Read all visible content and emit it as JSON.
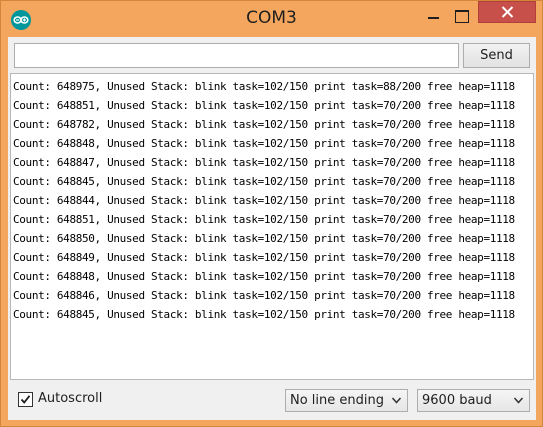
{
  "window": {
    "title": "COM3",
    "app_icon": "arduino-logo-icon",
    "controls": [
      "minimize-icon",
      "maximize-icon",
      "close-icon"
    ]
  },
  "send_bar": {
    "input_value": "",
    "send_label": "Send"
  },
  "output": {
    "lines": [
      "Count: 648975, Unused Stack: blink task=102/150 print task=88/200 free heap=1118",
      "Count: 648851, Unused Stack: blink task=102/150 print task=70/200 free heap=1118",
      "Count: 648782, Unused Stack: blink task=102/150 print task=70/200 free heap=1118",
      "Count: 648848, Unused Stack: blink task=102/150 print task=70/200 free heap=1118",
      "Count: 648847, Unused Stack: blink task=102/150 print task=70/200 free heap=1118",
      "Count: 648845, Unused Stack: blink task=102/150 print task=70/200 free heap=1118",
      "Count: 648844, Unused Stack: blink task=102/150 print task=70/200 free heap=1118",
      "Count: 648851, Unused Stack: blink task=102/150 print task=70/200 free heap=1118",
      "Count: 648850, Unused Stack: blink task=102/150 print task=70/200 free heap=1118",
      "Count: 648849, Unused Stack: blink task=102/150 print task=70/200 free heap=1118",
      "Count: 648848, Unused Stack: blink task=102/150 print task=70/200 free heap=1118",
      "Count: 648846, Unused Stack: blink task=102/150 print task=70/200 free heap=1118",
      "Count: 648845, Unused Stack: blink task=102/150 print task=70/200 free heap=1118"
    ]
  },
  "footer": {
    "autoscroll_label": "Autoscroll",
    "autoscroll_checked": true,
    "line_ending": "No line ending",
    "baud_rate": "9600 baud"
  },
  "colors": {
    "titlebar": "#f5a65e",
    "close_button": "#c7504a",
    "client_background": "#f0f0f0",
    "arduino_teal": "#00979c"
  }
}
